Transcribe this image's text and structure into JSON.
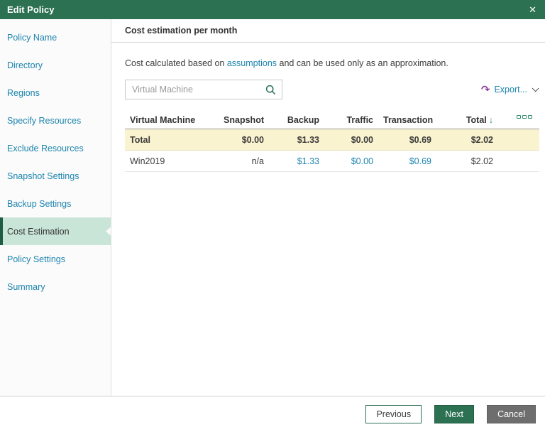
{
  "dialog": {
    "title": "Edit Policy",
    "close_icon": "✕"
  },
  "colors": {
    "header_green": "#2b7152",
    "sidebar_link_blue": "#1d84ae",
    "selected_step_bg": "#c9e5d7",
    "selected_step_border": "#1f5c44",
    "row_highlight_yellow": "#faf3cf",
    "export_icon_purple": "#8e3f97",
    "sort_icon_green": "#2f8c6b",
    "next_button_green": "#2b7152",
    "cancel_button_gray": "#6e6e6e"
  },
  "sidebar": {
    "items": [
      {
        "label": "Policy Name",
        "selected": false
      },
      {
        "label": "Directory",
        "selected": false
      },
      {
        "label": "Regions",
        "selected": false
      },
      {
        "label": "Specify Resources",
        "selected": false
      },
      {
        "label": "Exclude Resources",
        "selected": false
      },
      {
        "label": "Snapshot Settings",
        "selected": false
      },
      {
        "label": "Backup Settings",
        "selected": false
      },
      {
        "label": "Cost Estimation",
        "selected": true
      },
      {
        "label": "Policy Settings",
        "selected": false
      },
      {
        "label": "Summary",
        "selected": false
      }
    ]
  },
  "main": {
    "section_title": "Cost estimation per month",
    "description": {
      "prefix": "Cost calculated based on ",
      "link": "assumptions",
      "suffix": " and can be used only as an approximation."
    },
    "search": {
      "placeholder": "Virtual Machine"
    },
    "export": {
      "label": "Export...",
      "icon": "↷"
    },
    "table": {
      "columns": [
        "Virtual Machine",
        "Snapshot",
        "Backup",
        "Traffic",
        "Transaction",
        "Total"
      ],
      "sort": {
        "column": "Total",
        "direction": "descending",
        "icon": "↓"
      },
      "rows": [
        {
          "name": "Total",
          "snapshot": "$0.00",
          "backup": "$1.33",
          "traffic": "$0.00",
          "transaction": "$0.69",
          "total": "$2.02"
        },
        {
          "name": "Win2019",
          "snapshot": "n/a",
          "backup": "$1.33",
          "traffic": "$0.00",
          "transaction": "$0.69",
          "total": "$2.02"
        }
      ]
    }
  },
  "footer": {
    "previous": "Previous",
    "next": "Next",
    "cancel": "Cancel"
  }
}
